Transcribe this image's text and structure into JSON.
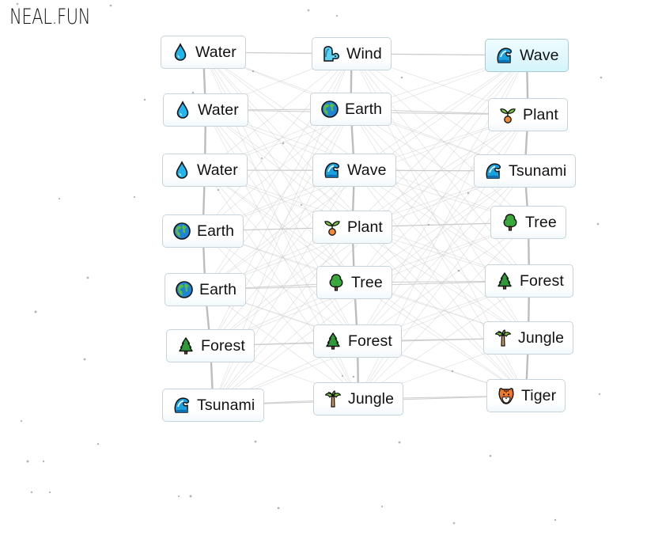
{
  "app": {
    "logo": "NEAL.FUN"
  },
  "colors": {
    "tile_border": "#c8d4da",
    "active_tile_bg": "#d5f4fb",
    "line": "#c9c9c9",
    "column_line": "#bdbdbd"
  },
  "columns": [
    {
      "name": "left",
      "items": [
        {
          "label": "Water",
          "icon": "water-drop-icon"
        },
        {
          "label": "Water",
          "icon": "water-drop-icon"
        },
        {
          "label": "Water",
          "icon": "water-drop-icon"
        },
        {
          "label": "Earth",
          "icon": "globe-icon"
        },
        {
          "label": "Earth",
          "icon": "globe-icon"
        },
        {
          "label": "Forest",
          "icon": "evergreen-tree-icon"
        },
        {
          "label": "Tsunami",
          "icon": "wave-icon"
        }
      ]
    },
    {
      "name": "middle",
      "items": [
        {
          "label": "Wind",
          "icon": "wind-face-icon"
        },
        {
          "label": "Earth",
          "icon": "globe-icon"
        },
        {
          "label": "Wave",
          "icon": "wave-icon"
        },
        {
          "label": "Plant",
          "icon": "seedling-icon"
        },
        {
          "label": "Tree",
          "icon": "deciduous-tree-icon"
        },
        {
          "label": "Forest",
          "icon": "evergreen-tree-icon"
        },
        {
          "label": "Jungle",
          "icon": "palm-tree-icon"
        }
      ]
    },
    {
      "name": "right",
      "items": [
        {
          "label": "Wave",
          "icon": "wave-icon",
          "active": true
        },
        {
          "label": "Plant",
          "icon": "seedling-icon"
        },
        {
          "label": "Tsunami",
          "icon": "wave-icon"
        },
        {
          "label": "Tree",
          "icon": "deciduous-tree-icon"
        },
        {
          "label": "Forest",
          "icon": "evergreen-tree-icon"
        },
        {
          "label": "Jungle",
          "icon": "palm-tree-icon"
        },
        {
          "label": "Tiger",
          "icon": "tiger-face-icon"
        }
      ]
    }
  ]
}
